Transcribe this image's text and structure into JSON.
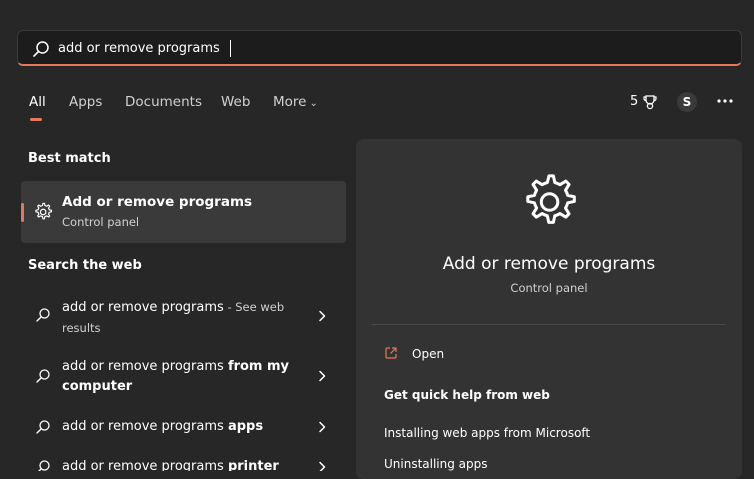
{
  "search": {
    "value": "add or remove programs",
    "icon": "search-icon"
  },
  "tabs": [
    {
      "label": "All",
      "active": true
    },
    {
      "label": "Apps"
    },
    {
      "label": "Documents"
    },
    {
      "label": "Web"
    },
    {
      "label": "More"
    }
  ],
  "header_right": {
    "points": "5",
    "trophy_icon": "trophy-icon",
    "avatar_initial": "S",
    "more_icon": "more-dots-icon"
  },
  "best_match": {
    "section_title": "Best match",
    "title": "Add or remove programs",
    "subtitle": "Control panel",
    "icon": "gear-icon"
  },
  "web": {
    "section_title": "Search the web",
    "items": [
      {
        "prefix": "add or remove programs",
        "bold": "",
        "suffix": " - See web results"
      },
      {
        "prefix": "add or remove programs ",
        "bold": "from my computer",
        "suffix": ""
      },
      {
        "prefix": "add or remove programs ",
        "bold": "apps",
        "suffix": ""
      },
      {
        "prefix": "add or remove programs ",
        "bold": "printer",
        "suffix": ""
      }
    ]
  },
  "preview": {
    "title": "Add or remove programs",
    "subtitle": "Control panel",
    "open_label": "Open",
    "quick_help_title": "Get quick help from web",
    "links": [
      "Installing web apps from Microsoft",
      "Uninstalling apps"
    ]
  },
  "colors": {
    "accent": "#e3785a",
    "background": "#272727",
    "panel": "#333333",
    "selected": "#3a3a3a"
  }
}
